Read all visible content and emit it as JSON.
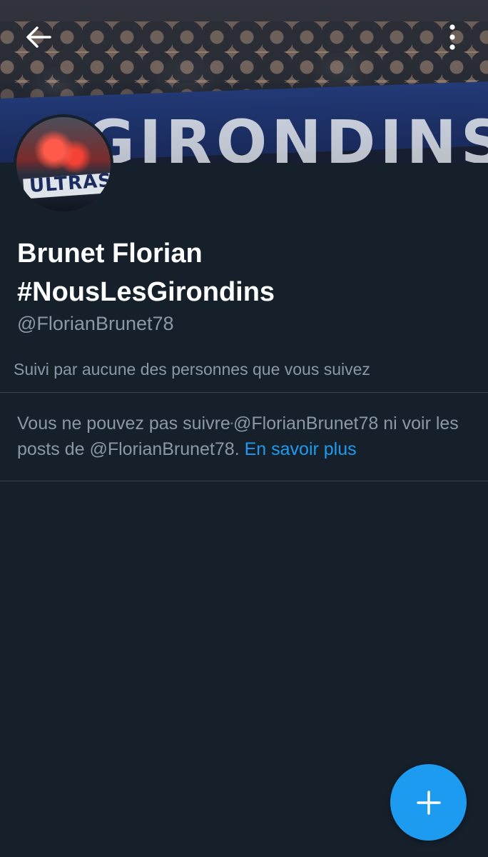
{
  "profile": {
    "display_name_line1": "Brunet Florian",
    "display_name_line2": "#NousLesGirondins",
    "handle": "@FlorianBrunet78",
    "followed_by": "Suivi par aucune des personnes que vous suivez"
  },
  "notice": {
    "text_part1": "Vous ne pouvez pas suivre",
    "text_part2": "@FlorianBrunet78 ni voir les posts de @FlorianBrunet78.",
    "link_label": "En savoir plus"
  },
  "header": {
    "back_icon": "arrow-left-icon",
    "more_icon": "more-vertical-icon"
  },
  "fab": {
    "icon": "plus-icon"
  },
  "colors": {
    "background": "#15202b",
    "accent": "#1d9bf0",
    "secondary_text": "#8b98a5",
    "divider": "#38444d"
  }
}
